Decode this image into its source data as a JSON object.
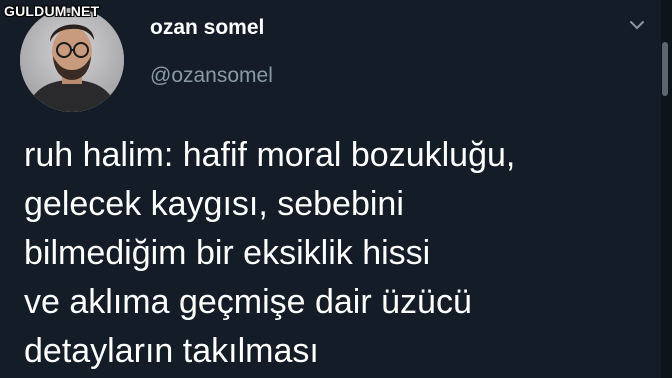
{
  "watermark": {
    "text": "GULDUM.NET"
  },
  "tweet": {
    "author": {
      "name": "ozan somel",
      "handle": "@ozansomel"
    },
    "menu_icon": "chevron-down-icon",
    "text_lines": [
      "ruh halim: hafif moral bozukluğu,",
      "gelecek kaygısı, sebebini",
      "bilmediğim bir eksiklik hissi",
      "ve aklıma geçmişe dair üzücü",
      "detayların takılması"
    ]
  },
  "colors": {
    "background": "#141d27",
    "text": "#ffffff",
    "handle": "#8899a6",
    "scrollbar": "#5c6670"
  }
}
